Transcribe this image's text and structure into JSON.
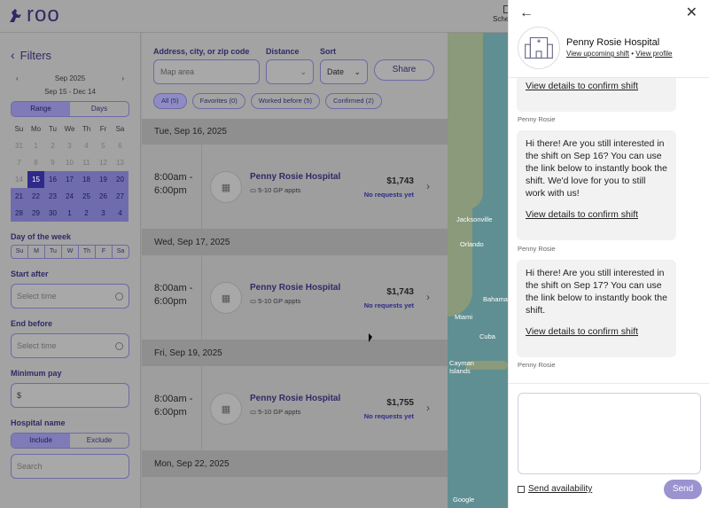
{
  "app": {
    "logo_text": "roo",
    "schedule_label": "Sche"
  },
  "filters": {
    "title": "Filters",
    "calendar": {
      "prev": "‹",
      "next": "›",
      "month": "Sep 2025",
      "range_text": "Sep 15 - Dec 14",
      "mode_range": "Range",
      "mode_days": "Days",
      "weekdays": [
        "Su",
        "Mo",
        "Tu",
        "We",
        "Th",
        "Fr",
        "Sa"
      ],
      "cells": [
        {
          "d": "31",
          "s": "dim"
        },
        {
          "d": "1",
          "s": "dim"
        },
        {
          "d": "2",
          "s": "dim"
        },
        {
          "d": "3",
          "s": "dim"
        },
        {
          "d": "4",
          "s": "dim"
        },
        {
          "d": "5",
          "s": "dim"
        },
        {
          "d": "6",
          "s": "dim"
        },
        {
          "d": "7",
          "s": "dim"
        },
        {
          "d": "8",
          "s": "dim"
        },
        {
          "d": "9",
          "s": "dim"
        },
        {
          "d": "10",
          "s": "dim"
        },
        {
          "d": "11",
          "s": "dim"
        },
        {
          "d": "12",
          "s": "dim"
        },
        {
          "d": "13",
          "s": "dim"
        },
        {
          "d": "14",
          "s": "dim"
        },
        {
          "d": "15",
          "s": "start"
        },
        {
          "d": "16",
          "s": "sel"
        },
        {
          "d": "17",
          "s": "sel"
        },
        {
          "d": "18",
          "s": "sel"
        },
        {
          "d": "19",
          "s": "sel"
        },
        {
          "d": "20",
          "s": "sel"
        },
        {
          "d": "21",
          "s": "sel"
        },
        {
          "d": "22",
          "s": "sel"
        },
        {
          "d": "23",
          "s": "sel"
        },
        {
          "d": "24",
          "s": "sel"
        },
        {
          "d": "25",
          "s": "sel"
        },
        {
          "d": "26",
          "s": "sel"
        },
        {
          "d": "27",
          "s": "sel"
        },
        {
          "d": "28",
          "s": "sel"
        },
        {
          "d": "29",
          "s": "sel"
        },
        {
          "d": "30",
          "s": "sel"
        },
        {
          "d": "1",
          "s": "sel"
        },
        {
          "d": "2",
          "s": "sel"
        },
        {
          "d": "3",
          "s": "sel"
        },
        {
          "d": "4",
          "s": "sel"
        }
      ]
    },
    "day_of_week_label": "Day of the week",
    "days": [
      "Su",
      "M",
      "Tu",
      "W",
      "Th",
      "F",
      "Sa"
    ],
    "start_after_label": "Start after",
    "start_after_placeholder": "Select time",
    "end_before_label": "End before",
    "end_before_placeholder": "Select time",
    "min_pay_label": "Minimum pay",
    "min_pay_prefix": "$",
    "hospital_label": "Hospital name",
    "include": "Include",
    "exclude": "Exclude",
    "search_placeholder": "Search"
  },
  "controls": {
    "address_label": "Address, city, or zip code",
    "address_placeholder": "Map area",
    "distance_label": "Distance",
    "sort_label": "Sort",
    "sort_value": "Date",
    "share": "Share",
    "chips": [
      "All (5)",
      "Favorites (0)",
      "Worked before (5)",
      "Confirmed (2)"
    ]
  },
  "shifts": [
    {
      "day": "Tue, Sep 16, 2025",
      "time1": "8:00am -",
      "time2": "6:00pm",
      "hospital": "Penny Rosie Hospital",
      "appts": "5-10 GP appts",
      "price": "$1,743",
      "status": "No requests yet"
    },
    {
      "day": "Wed, Sep 17, 2025",
      "time1": "8:00am -",
      "time2": "6:00pm",
      "hospital": "Penny Rosie Hospital",
      "appts": "5-10 GP appts",
      "price": "$1,743",
      "status": "No requests yet"
    },
    {
      "day": "Fri, Sep 19, 2025",
      "time1": "8:00am -",
      "time2": "6:00pm",
      "hospital": "Penny Rosie Hospital",
      "appts": "5-10 GP appts",
      "price": "$1,755",
      "status": "No requests yet"
    },
    {
      "day": "Mon, Sep 22, 2025"
    }
  ],
  "map": {
    "labels": [
      "Jacksonville",
      "Orlando",
      "Miami",
      "Bahamas",
      "Cuba",
      "Cayman Islands",
      "Google"
    ]
  },
  "chat": {
    "hospital": "Penny Rosie Hospital",
    "link_upcoming": "View upcoming shift",
    "link_dot": "•",
    "link_profile": "View profile",
    "messages": [
      {
        "text": "",
        "link": "View details to confirm shift",
        "sender": "Penny Rosie"
      },
      {
        "text": "Hi there! Are you still interested in the shift on Sep 16? You can use the link below to instantly book the shift. We'd love for you to still work with us!",
        "link": "View details to confirm shift",
        "sender": "Penny Rosie"
      },
      {
        "text": "Hi there! Are you still interested in the shift on Sep 17? You can use the link below to instantly book the shift.",
        "link": "View details to confirm shift",
        "sender": "Penny Rosie"
      }
    ],
    "send_availability": "Send availability",
    "send": "Send"
  }
}
